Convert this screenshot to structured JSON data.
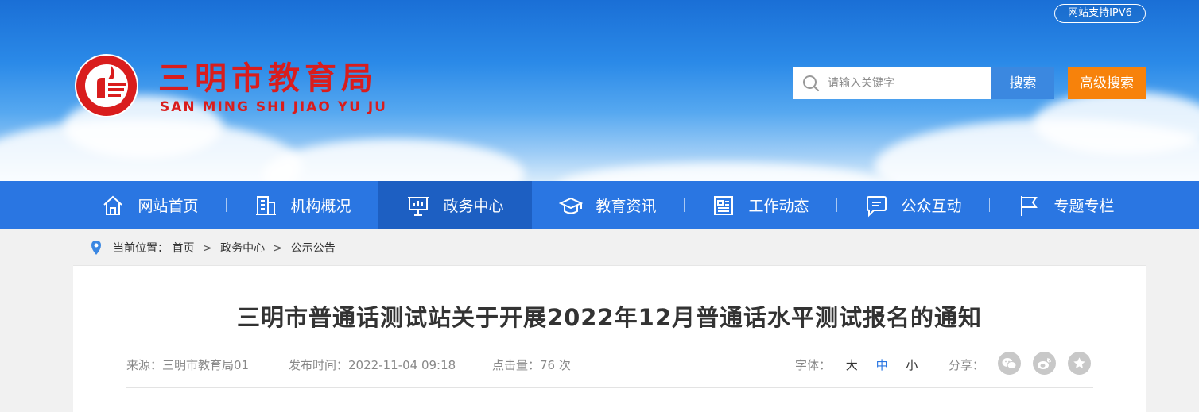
{
  "header": {
    "ipv6_badge": "网站支持IPV6",
    "site_title": "三明市教育局",
    "site_pinyin": "SAN MING SHI JIAO YU JU",
    "search": {
      "placeholder": "请输入关键字",
      "search_label": "搜索",
      "advanced_label": "高级搜索"
    },
    "colors": {
      "title_red": "#d91d1d",
      "search_blue": "#3b88e0",
      "advanced_orange": "#f7820b"
    }
  },
  "nav": {
    "active_index": 2,
    "items": [
      {
        "label": "网站首页",
        "icon": "home-icon"
      },
      {
        "label": "机构概况",
        "icon": "building-icon"
      },
      {
        "label": "政务中心",
        "icon": "presentation-icon"
      },
      {
        "label": "教育资讯",
        "icon": "graduation-cap-icon"
      },
      {
        "label": "工作动态",
        "icon": "news-icon"
      },
      {
        "label": "公众互动",
        "icon": "chat-icon"
      },
      {
        "label": "专题专栏",
        "icon": "flag-icon"
      }
    ],
    "colors": {
      "bar": "#2a76e2",
      "active": "#1d5fc2"
    }
  },
  "breadcrumb": {
    "prefix": "当前位置：",
    "sep": ">",
    "items": [
      "首页",
      "政务中心",
      "公示公告"
    ]
  },
  "article": {
    "title": "三明市普通话测试站关于开展2022年12月普通话水平测试报名的通知",
    "source_label": "来源：",
    "source_value": "三明市教育局01",
    "time_label": "发布时间：",
    "time_value": "2022-11-04 09:18",
    "views_label": "点击量：",
    "views_value": "76 次",
    "fontsize_label": "字体：",
    "fontsize_options": [
      "大",
      "中",
      "小"
    ],
    "fontsize_selected": "中",
    "share_label": "分享：",
    "share_icons": [
      "wechat-icon",
      "weibo-icon",
      "favorite-star-icon"
    ]
  }
}
